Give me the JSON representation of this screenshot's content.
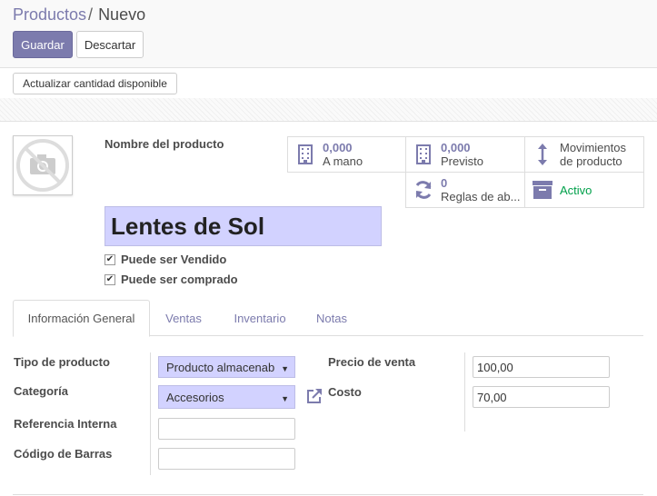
{
  "breadcrumb": {
    "parent": "Productos",
    "separator": "/",
    "current": "Nuevo"
  },
  "buttons": {
    "save": "Guardar",
    "discard": "Descartar",
    "update_qty": "Actualizar cantidad disponible"
  },
  "product": {
    "name_label": "Nombre del producto",
    "name": "Lentes de Sol",
    "can_be_sold": "Puede ser Vendido",
    "can_be_purchased": "Puede ser comprado"
  },
  "smart_buttons": {
    "on_hand": {
      "value": "0,000",
      "label": "A mano"
    },
    "forecast": {
      "value": "0,000",
      "label": "Previsto"
    },
    "moves": {
      "line1": "Movimientos",
      "line2": "de producto"
    },
    "reorder": {
      "value": "0",
      "label": "Reglas de ab..."
    },
    "active": {
      "label": "Activo"
    }
  },
  "tabs": [
    "Información General",
    "Ventas",
    "Inventario",
    "Notas"
  ],
  "form": {
    "type_label": "Tipo de producto",
    "type_value": "Producto almacenab",
    "category_label": "Categoría",
    "category_value": "Accesorios",
    "internal_ref_label": "Referencia Interna",
    "internal_ref_value": "",
    "barcode_label": "Código de Barras",
    "barcode_value": "",
    "sale_price_label": "Precio de venta",
    "sale_price_value": "100,00",
    "cost_label": "Costo",
    "cost_value": "70,00"
  },
  "colors": {
    "primary": "#7c7bad",
    "required_bg": "#d2d2ff",
    "active_green": "#00a04a"
  },
  "icons": [
    "no-image-icon",
    "building-icon",
    "arrows-vertical-icon",
    "refresh-icon",
    "archive-icon",
    "external-link-icon",
    "caret-down-icon",
    "checkbox-checked-icon"
  ]
}
